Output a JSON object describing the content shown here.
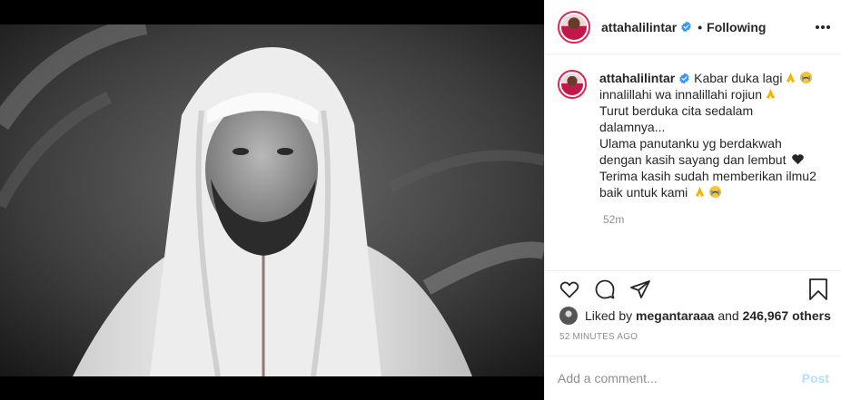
{
  "post": {
    "username": "attahalilintar",
    "verified": true,
    "follow_status": "Following",
    "separator": "•"
  },
  "caption": {
    "username": "attahalilintar",
    "lines": [
      "Kabar duka lagi",
      "innalillahi wa innalillahi rojiun",
      "Turut berduka cita sedalam",
      "dalamnya...",
      "Ulama panutanku yg berdakwah",
      "dengan kasih sayang dan lembut",
      "Terima kasih sudah memberikan ilmu2",
      "baik untuk kami"
    ],
    "time_ago": "52m"
  },
  "likes": {
    "prefix": "Liked by",
    "user": "megantaraaa",
    "middle": "and",
    "count": "246,967 others"
  },
  "posted_time": "52 MINUTES AGO",
  "comment_box": {
    "placeholder": "Add a comment...",
    "post_label": "Post"
  },
  "icons": {
    "heart": "heart-icon",
    "comment": "comment-icon",
    "share": "share-icon",
    "save": "bookmark-icon",
    "more": "more-options-icon",
    "verified": "verified-badge-icon",
    "pray": "pray-emoji",
    "cry": "crying-emoji",
    "black_heart": "black-heart-emoji"
  },
  "colors": {
    "verified_blue": "#3897f0",
    "link_muted": "#b2dffc",
    "secondary_text": "#8e8e8e",
    "avatar_ring": "#e3244f"
  }
}
